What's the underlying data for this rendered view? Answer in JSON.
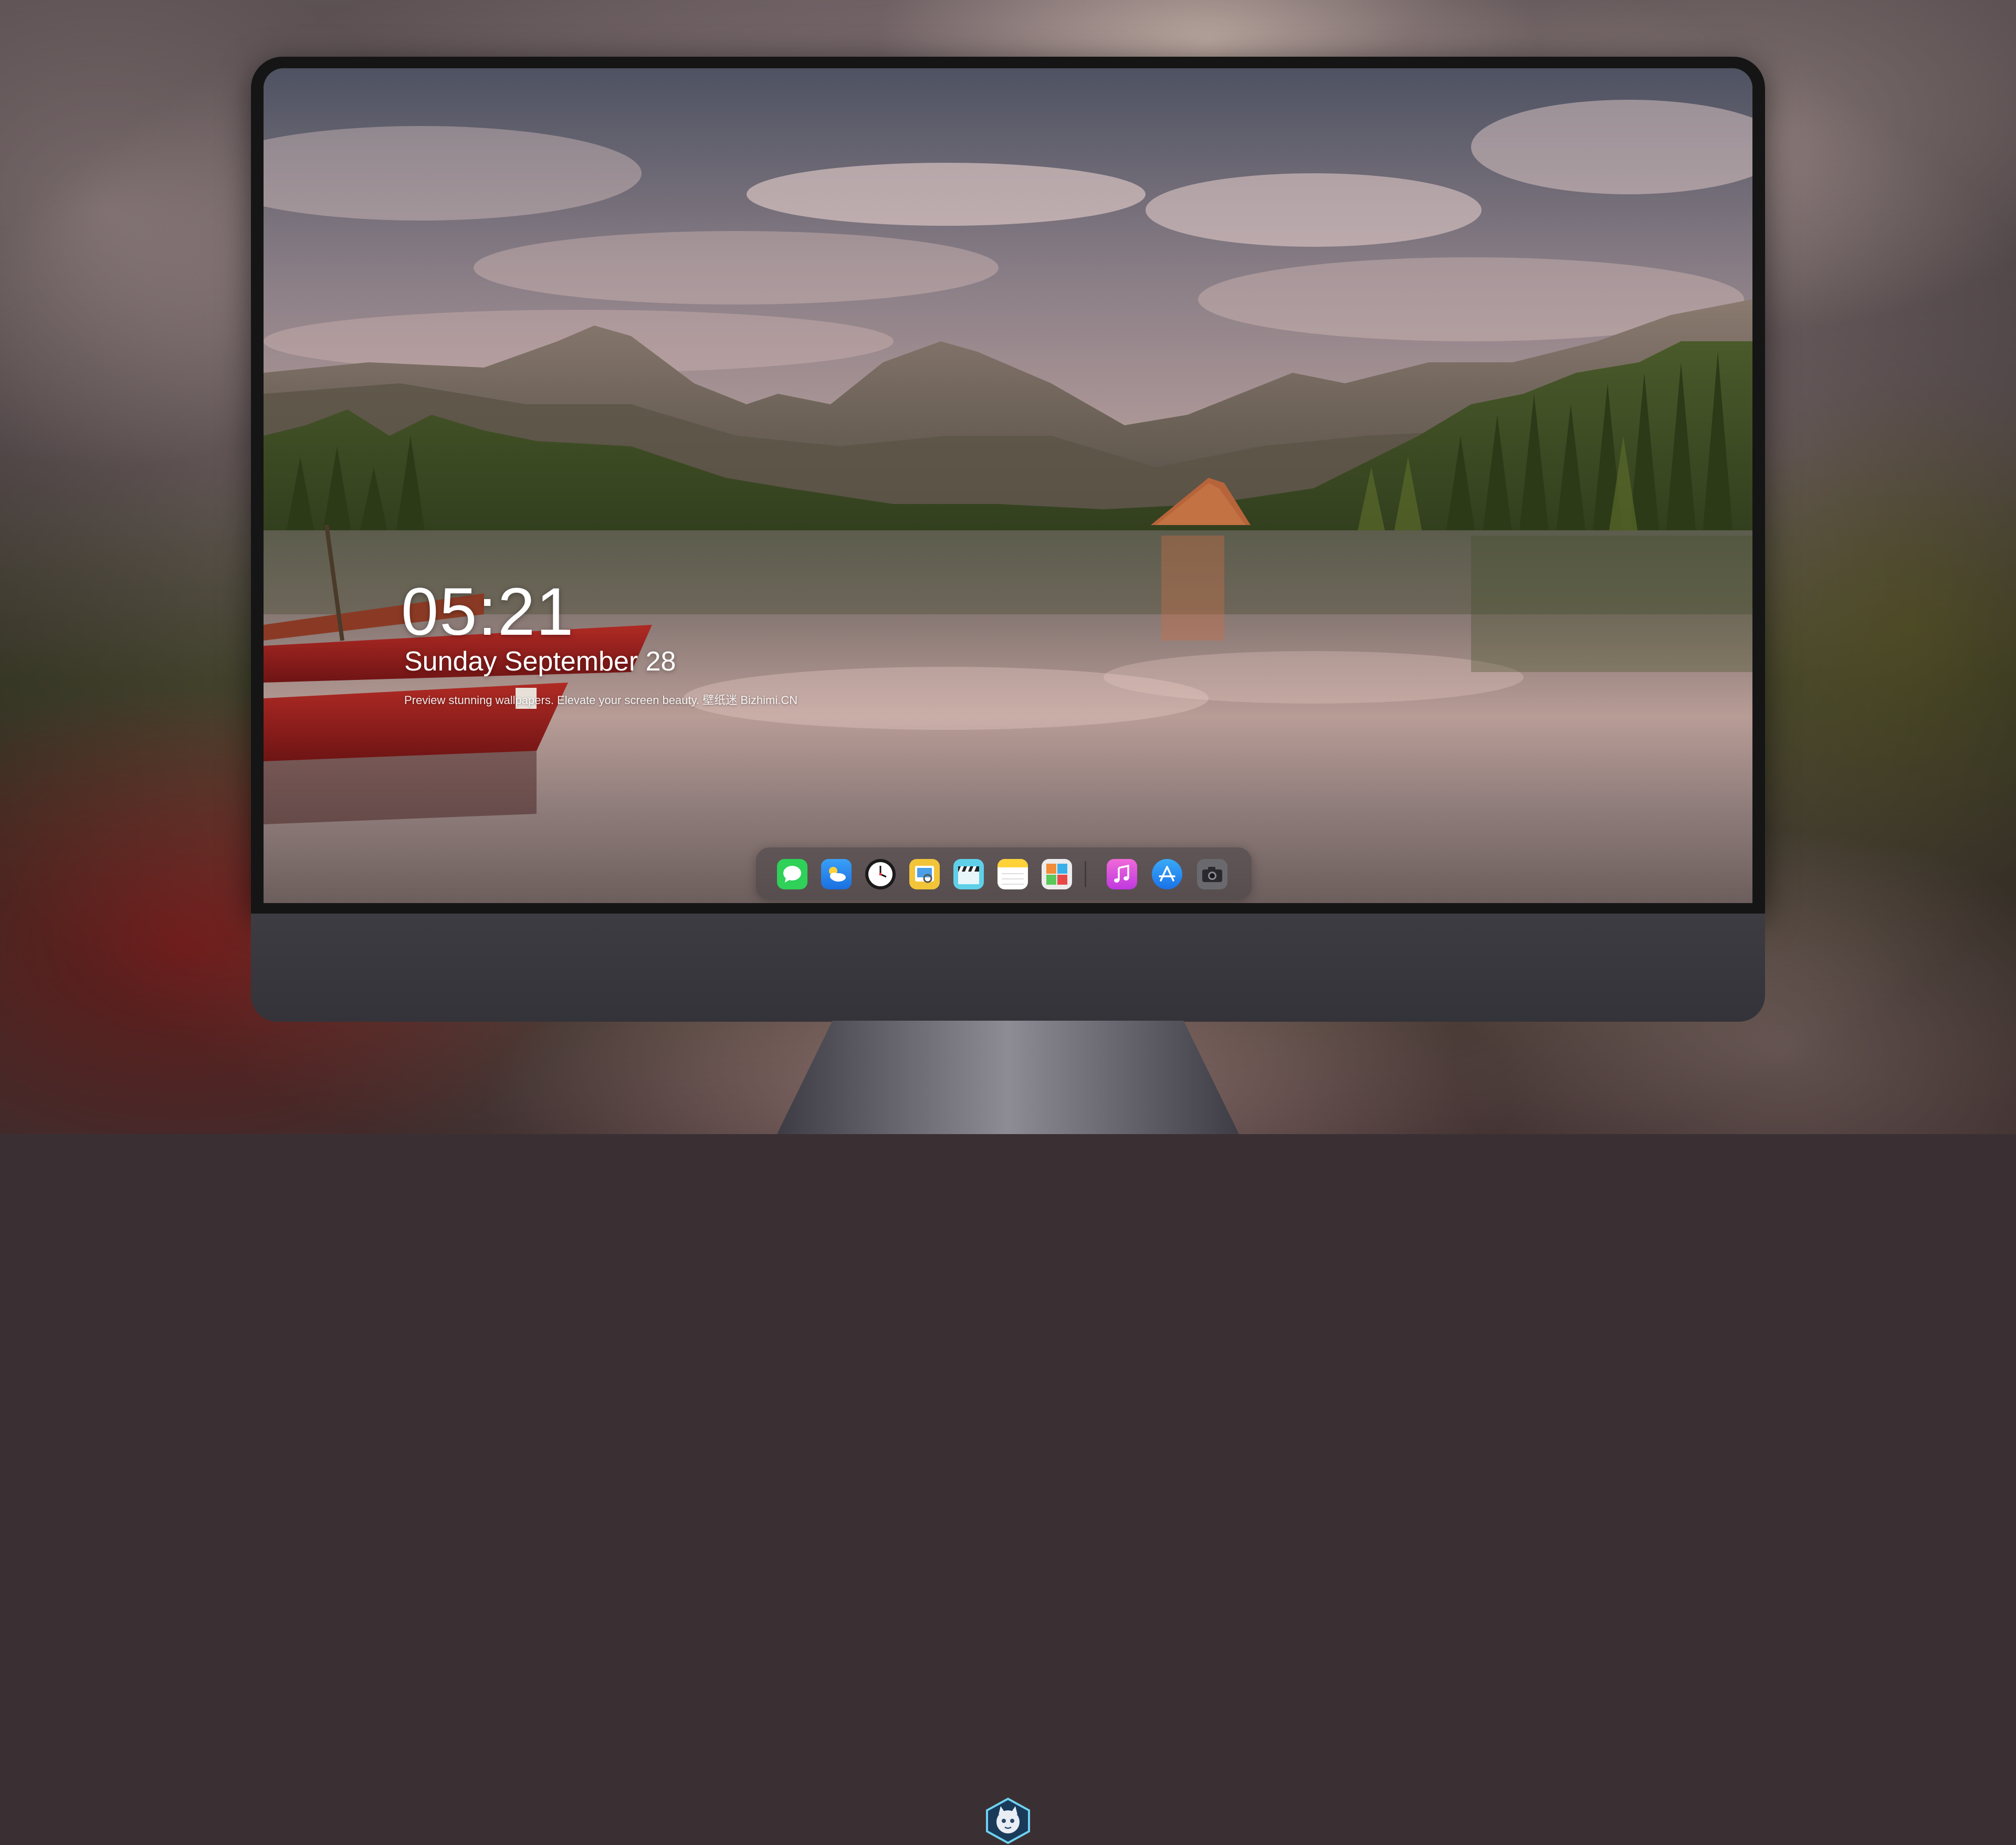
{
  "lockscreen": {
    "time": "05:21",
    "date": "Sunday September  28",
    "tagline": "Preview stunning wallpapers. Elevate your screen beauty. 壁纸迷 Bizhimi.CN"
  },
  "dock": {
    "apps": [
      {
        "name": "messages",
        "icon": "message-bubble-icon",
        "color": "#2fd158"
      },
      {
        "name": "weather",
        "icon": "cloud-sun-icon",
        "color": "#2a8ef2"
      },
      {
        "name": "clock",
        "icon": "clock-icon",
        "color": "#ffffff"
      },
      {
        "name": "preview",
        "icon": "image-viewer-icon",
        "color": "#f2c438"
      },
      {
        "name": "video",
        "icon": "clapperboard-icon",
        "color": "#5fd0e8"
      },
      {
        "name": "notes",
        "icon": "notepad-icon",
        "color": "#ffd23a"
      },
      {
        "name": "photo-gallery",
        "icon": "photo-collage-icon",
        "color": "#e8e8e8"
      },
      {
        "name": "music",
        "icon": "music-note-icon",
        "color": "#e648c8"
      },
      {
        "name": "app-store",
        "icon": "app-store-icon",
        "color": "#1e8cf2"
      },
      {
        "name": "camera",
        "icon": "camera-icon",
        "color": "#6a6a6e"
      }
    ]
  },
  "monitor": {
    "logo": "cat-mascot-logo-icon"
  },
  "colors": {
    "bezel": "#151515",
    "chin": "#3a3940",
    "lake": "#9a8788",
    "boat_red": "#9e2222"
  }
}
